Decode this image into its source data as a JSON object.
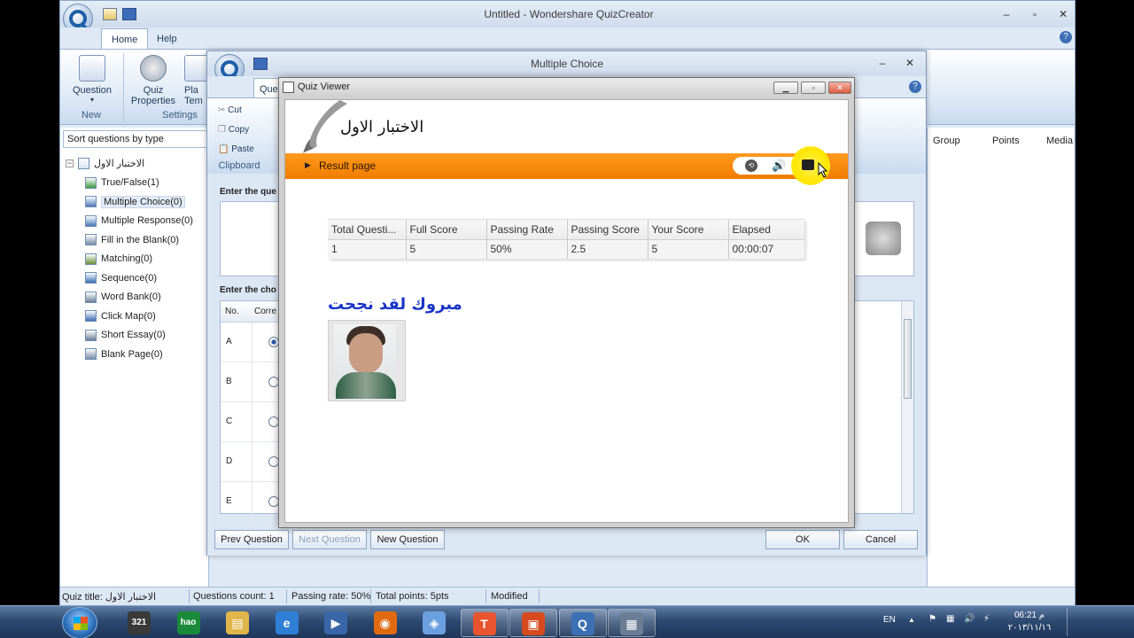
{
  "main_window": {
    "title": "Untitled - Wondershare QuizCreator",
    "caption_buttons": [
      "–",
      "▫",
      "✕"
    ],
    "tabs": [
      {
        "label": "Home"
      },
      {
        "label": "Help"
      }
    ],
    "ribbon": {
      "question_label": "Question",
      "new_group": "New",
      "quiz_properties_line1": "Quiz",
      "quiz_properties_line2": "Properties",
      "player_template_line1": "Pla",
      "player_template_line2": "Tem",
      "settings_group": "Settings"
    },
    "sort_label": "Sort questions by type",
    "tree_root": "الاختبار الاول",
    "tree_items": [
      {
        "label": "True/False(1)",
        "icon": "true-false-icon"
      },
      {
        "label": "Multiple Choice(0)",
        "icon": "multiple-choice-icon"
      },
      {
        "label": "Multiple Response(0)",
        "icon": "multiple-response-icon"
      },
      {
        "label": "Fill in the Blank(0)",
        "icon": "fill-blank-icon"
      },
      {
        "label": "Matching(0)",
        "icon": "matching-icon"
      },
      {
        "label": "Sequence(0)",
        "icon": "sequence-icon"
      },
      {
        "label": "Word Bank(0)",
        "icon": "word-bank-icon"
      },
      {
        "label": "Click Map(0)",
        "icon": "click-map-icon"
      },
      {
        "label": "Short Essay(0)",
        "icon": "short-essay-icon"
      },
      {
        "label": "Blank Page(0)",
        "icon": "blank-page-icon"
      }
    ],
    "list_columns": [
      "Group",
      "Points",
      "Media"
    ],
    "status": {
      "quiz_title": "Quiz title: الاختبار الاول",
      "questions_count": "Questions count: 1",
      "passing_rate": "Passing rate: 50%",
      "total_points": "Total points: 5pts",
      "modified": "Modified"
    }
  },
  "mc_dialog": {
    "title": "Multiple Choice",
    "caption_buttons": [
      "–",
      "✕"
    ],
    "tab_partial": "Ques",
    "clipboard": {
      "cut": "Cut",
      "copy": "Copy",
      "paste": "Paste",
      "group": "Clipboard"
    },
    "enter_question": "Enter the que",
    "enter_choices": "Enter the cho",
    "choices_header_no": "No.",
    "choices_header_correct": "Corre",
    "choices": [
      "A",
      "B",
      "C",
      "D",
      "E"
    ],
    "selected_choice": "A",
    "buttons": {
      "prev": "Prev Question",
      "next": "Next Question",
      "new": "New Question",
      "ok": "OK",
      "cancel": "Cancel"
    }
  },
  "quiz_viewer": {
    "title": "Quiz Viewer",
    "quiz_title": "الاختبار الاول",
    "result_label": "Result page",
    "toolbar_icons": [
      "review-icon",
      "sound-icon",
      "print-icon"
    ],
    "results_table": {
      "headers": [
        "Total Questi...",
        "Full Score",
        "Passing Rate",
        "Passing Score",
        "Your Score",
        "Elapsed"
      ],
      "row": [
        "1",
        "5",
        "50%",
        "2.5",
        "5",
        "00:00:07"
      ]
    },
    "message": "مبروك لقد نجحت",
    "message_color": "#1a34c8",
    "accent_orange": "#f58a0c"
  },
  "taskbar": {
    "apps": [
      "start-orb",
      "calendar-321-app",
      "hao123-app",
      "file-explorer-app",
      "internet-explorer-app",
      "media-player-app",
      "firefox-app",
      "browser-app",
      "text-app",
      "presentation-app",
      "quizcreator-app",
      "quiz-viewer-app"
    ],
    "lang": "EN",
    "time": "06:21 م",
    "date": "٢٠١٣/١١/١٦"
  }
}
